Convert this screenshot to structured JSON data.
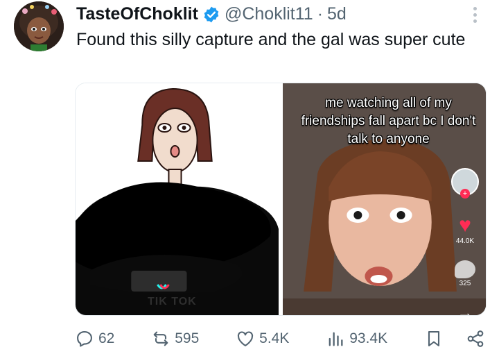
{
  "author": {
    "display_name": "TasteOfChoklit",
    "handle": "@Choklit11",
    "separator": "·",
    "time": "5d"
  },
  "tweet": {
    "text": "Found this silly capture and the gal was super cute"
  },
  "media": {
    "left_watermark": "TIK TOK",
    "right_caption": "me watching all of my friendships fall apart bc I don't talk to anyone",
    "right_like_count": "44.0K",
    "right_comment_count": "325"
  },
  "actions": {
    "replies": "62",
    "reposts": "595",
    "likes": "5.4K",
    "views": "93.4K"
  },
  "colors": {
    "text": "#0f1419",
    "muted": "#536471",
    "verified": "#1d9bf0",
    "tiktok_red": "#fe2c55"
  },
  "icons": [
    "avatar",
    "verified-badge-icon",
    "more-icon",
    "reply-icon",
    "repost-icon",
    "like-icon",
    "views-icon",
    "bookmark-icon",
    "share-icon"
  ]
}
